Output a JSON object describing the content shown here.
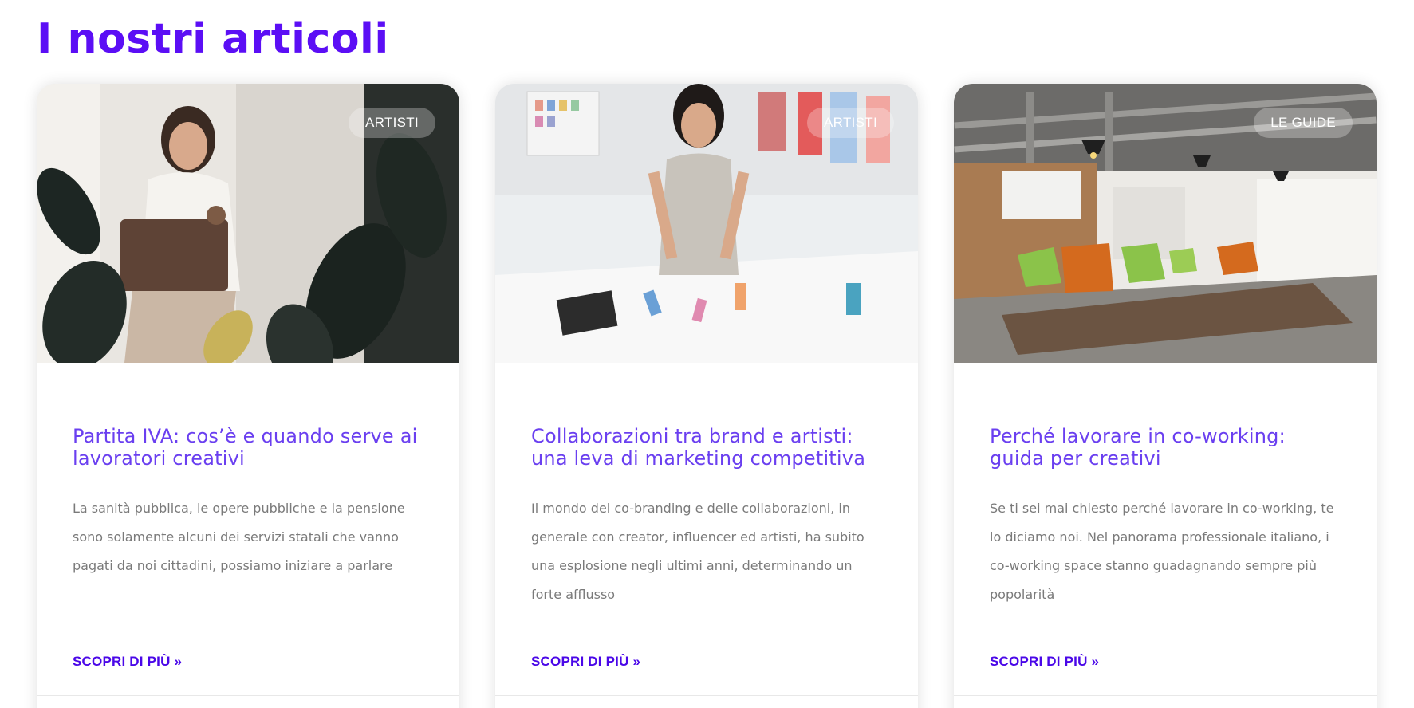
{
  "section": {
    "title": "I nostri articoli"
  },
  "cards": [
    {
      "badge": "ARTISTI",
      "title": "Partita IVA: cos’è e quando serve ai lavoratori creativi",
      "excerpt": "La sanità pubblica, le opere pubbliche e la pensione sono solamente alcuni dei servizi statali che vanno pagati da noi cittadini, possiamo iniziare a parlare",
      "read_more": "SCOPRI DI PIÙ »",
      "image": "woman-with-laptop-and-plant"
    },
    {
      "badge": "ARTISTI",
      "title": "Collaborazioni tra brand e artisti: una leva di marketing competitiva",
      "excerpt": "Il mondo del co-branding e delle collaborazioni, in generale con creator, influencer ed artisti, ha subito una esplosione negli ultimi anni, determinando un forte afflusso",
      "read_more": "SCOPRI DI PIÙ »",
      "image": "fashion-designer-studio"
    },
    {
      "badge": "LE GUIDE",
      "title": "Perché lavorare in co-working: guida per creativi",
      "excerpt": "Se ti sei mai chiesto perché lavorare in co-working, te lo diciamo noi. Nel panorama professionale italiano, i co-working space stanno guadagnando sempre più popolarità",
      "read_more": "SCOPRI DI PIÙ »",
      "image": "coworking-office-lounge"
    }
  ],
  "colors": {
    "accent": "#5b0ef5",
    "card_title": "#6a3ff0",
    "link": "#4a07e8",
    "text_muted": "#7a7a7a"
  }
}
